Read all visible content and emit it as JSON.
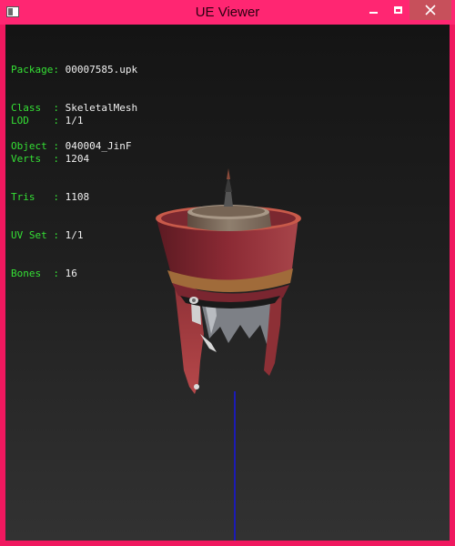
{
  "window": {
    "title": "UE Viewer",
    "colors": {
      "frame": "#f0185f",
      "titlebar": "#ff2672",
      "close": "#c7505b",
      "label": "#35e035",
      "value": "#f0f0f0",
      "axis": "#1b1bb5"
    }
  },
  "info_block_1": [
    {
      "label": "Package:",
      "value": "00007585.upk"
    },
    {
      "label": "Class  :",
      "value": "SkeletalMesh"
    },
    {
      "label": "Object :",
      "value": "040004_JinF"
    }
  ],
  "info_block_2": [
    {
      "label": "LOD    :",
      "value": "1/1"
    },
    {
      "label": "Verts  :",
      "value": "1204"
    },
    {
      "label": "Tris   :",
      "value": "1108"
    },
    {
      "label": "UV Set :",
      "value": "1/1"
    },
    {
      "label": "Bones  :",
      "value": "16"
    }
  ]
}
